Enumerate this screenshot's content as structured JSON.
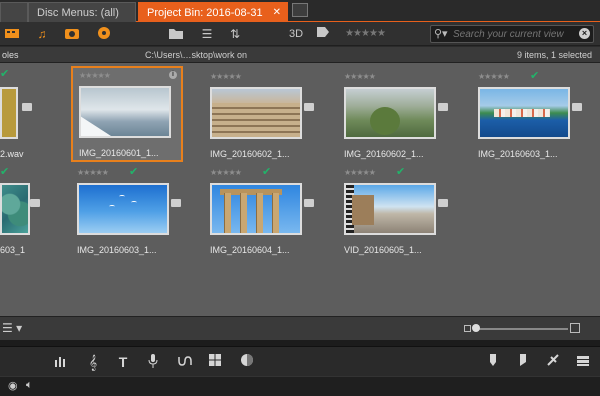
{
  "tabs": {
    "partial_tab": "",
    "disc_menus": "Disc Menus: (all)",
    "project_bin": "Project Bin: 2016-08-31",
    "close": "✕"
  },
  "toolbar": {
    "search_placeholder": "Search your current view",
    "three_d": "3D",
    "stars": "★★★★★"
  },
  "pathbar": {
    "left": "oles",
    "path": "C:\\Users\\…sktop\\work on",
    "status": "9 items, 1 selected"
  },
  "items": [
    {
      "caption": "2.wav"
    },
    {
      "caption": "IMG_20160601_1..."
    },
    {
      "caption": "IMG_20160602_1..."
    },
    {
      "caption": "IMG_20160602_1..."
    },
    {
      "caption": "IMG_20160603_1..."
    },
    {
      "caption": "603_1"
    },
    {
      "caption": "IMG_20160603_1..."
    },
    {
      "caption": "IMG_20160604_1..."
    },
    {
      "caption": "VID_20160605_1..."
    }
  ],
  "icons": {
    "film": "film-icon",
    "music": "music-icon",
    "photo": "camera-icon",
    "disc": "disc-icon",
    "folder": "folder-icon",
    "list": "list-view-icon",
    "sort": "sort-icon",
    "search": "search-icon",
    "clear": "clear-icon",
    "menu": "menu-icon"
  },
  "colors": {
    "accent": "#e8601c",
    "selected_border": "#e8801c",
    "check": "#22b36a"
  }
}
